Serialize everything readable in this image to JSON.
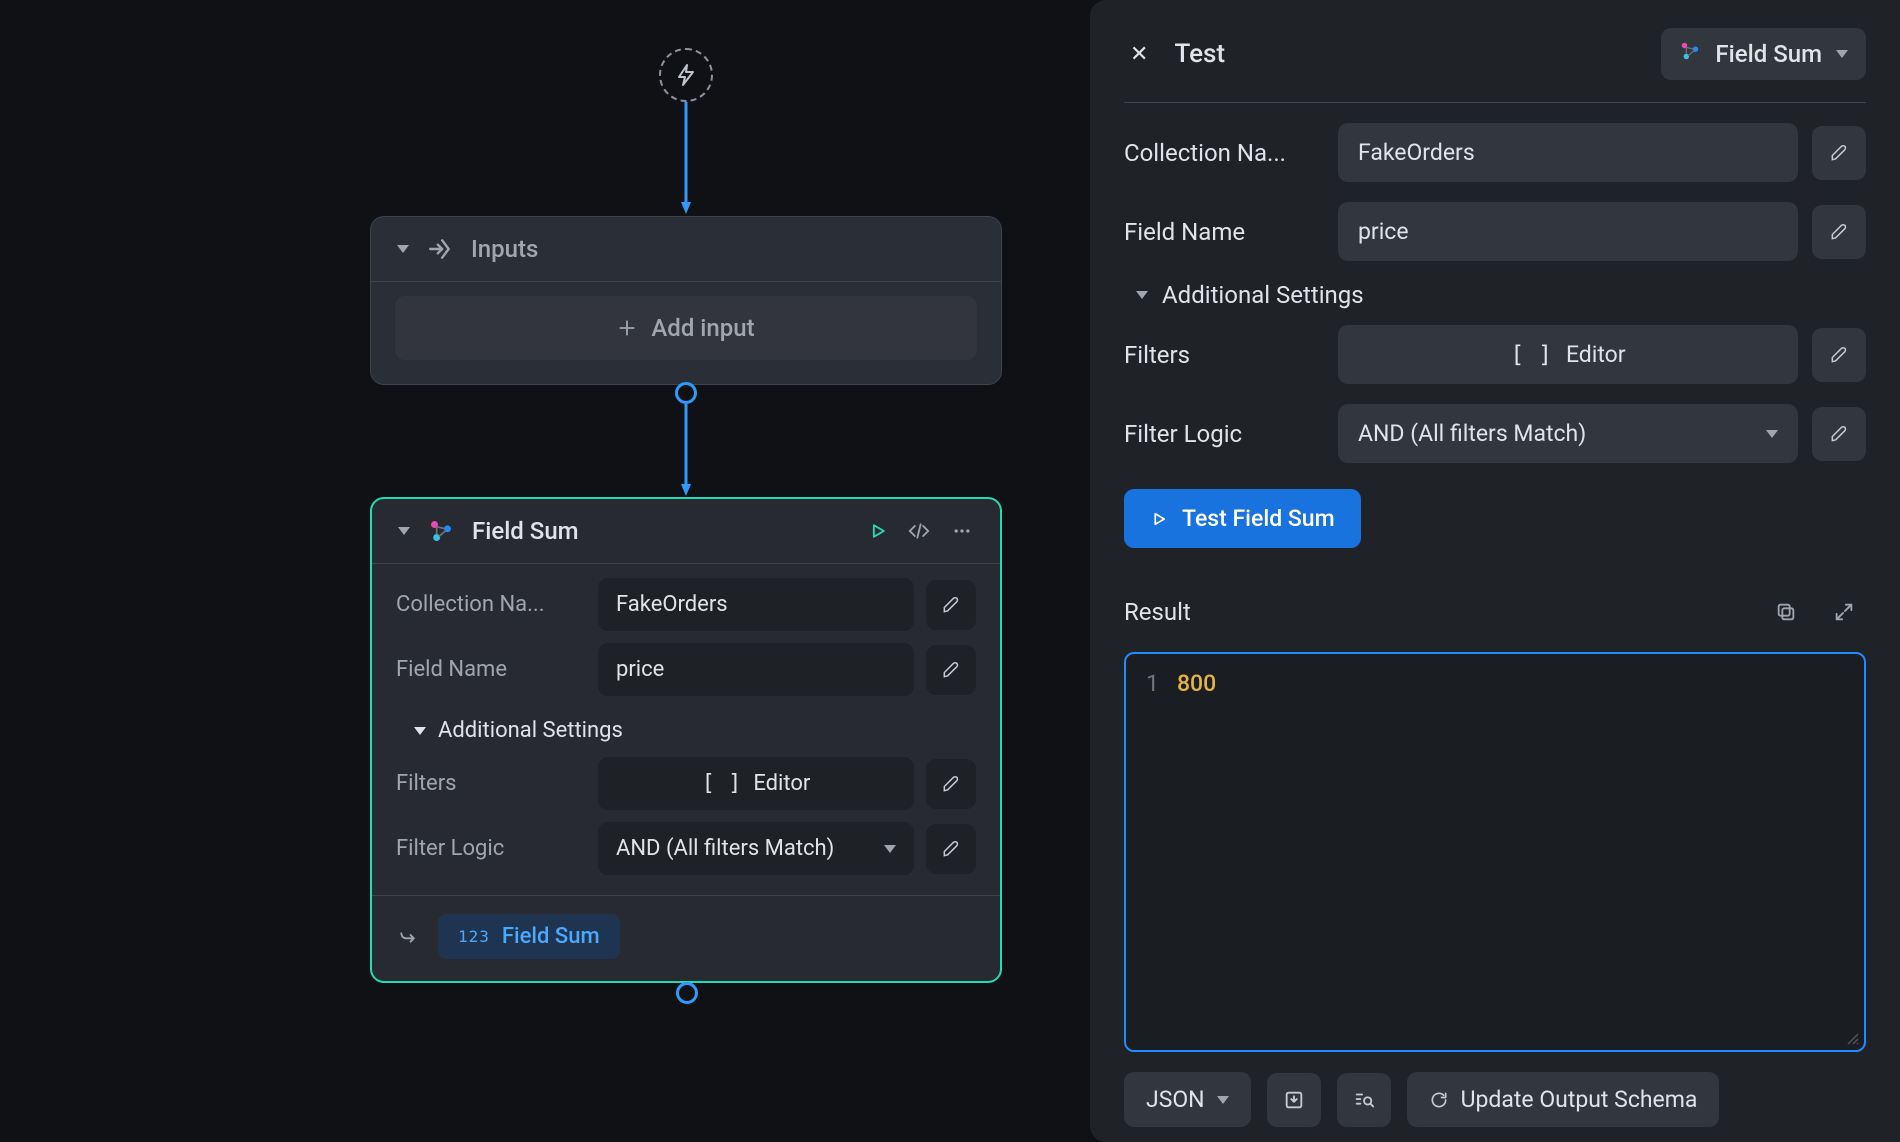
{
  "canvas": {
    "nodes": {
      "inputs": {
        "title": "Inputs",
        "add_button": "Add input"
      },
      "field_sum": {
        "title": "Field Sum",
        "fields": {
          "collection_name": {
            "label": "Collection Na...",
            "value": "FakeOrders"
          },
          "field_name": {
            "label": "Field Name",
            "value": "price"
          }
        },
        "additional_label": "Additional Settings",
        "filters": {
          "label": "Filters",
          "button_prefix": "[ ]",
          "button_label": "Editor"
        },
        "filter_logic": {
          "label": "Filter Logic",
          "value": "AND (All filters Match)"
        },
        "output_chip": {
          "prefix": "123",
          "label": "Field Sum"
        }
      }
    }
  },
  "panel": {
    "header": {
      "close_label": "✕",
      "title": "Test",
      "selector_label": "Field Sum"
    },
    "fields": {
      "collection_name": {
        "label": "Collection Na...",
        "value": "FakeOrders"
      },
      "field_name": {
        "label": "Field Name",
        "value": "price"
      }
    },
    "additional_label": "Additional Settings",
    "filters": {
      "label": "Filters",
      "button_prefix": "[ ]",
      "button_label": "Editor"
    },
    "filter_logic": {
      "label": "Filter Logic",
      "value": "AND (All filters Match)"
    },
    "test_button": "Test Field Sum",
    "result": {
      "title": "Result",
      "line_number": "1",
      "value": "800"
    },
    "footer": {
      "format_selector": "JSON",
      "update_schema": "Update Output Schema"
    }
  }
}
